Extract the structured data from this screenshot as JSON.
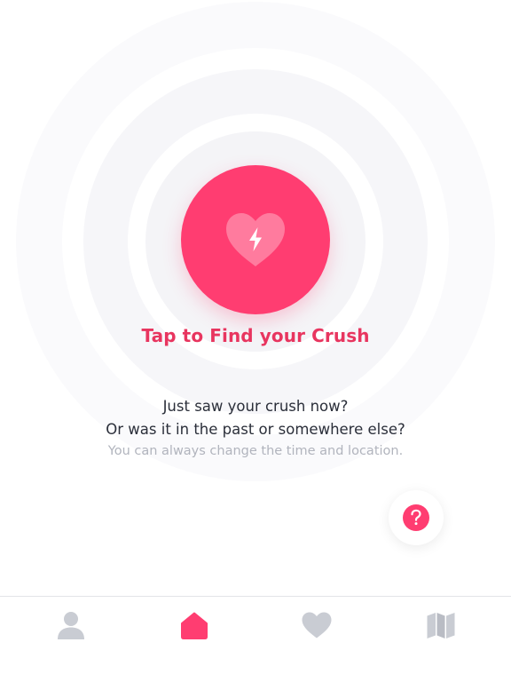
{
  "main": {
    "cta_title": "Tap to Find your Crush",
    "description_line1": "Just saw your crush now?",
    "description_line2": "Or was it in the past or somewhere else?",
    "hint": "You can always change the time and location.",
    "find_button_icon": "heart-bolt-icon",
    "help_button_icon": "question-icon"
  },
  "tabbar": {
    "active_tab": "home",
    "tabs": [
      {
        "id": "profile",
        "icon": "person-icon",
        "active": false
      },
      {
        "id": "home",
        "icon": "home-icon",
        "active": true
      },
      {
        "id": "likes",
        "icon": "heart-icon",
        "active": false
      },
      {
        "id": "map",
        "icon": "map-icon",
        "active": false
      }
    ]
  },
  "colors": {
    "accent": "#ff3d71",
    "title": "#e8355f",
    "text": "#2b2f3a",
    "muted": "#b1b4bd",
    "inactive_icon": "#c9ccd3"
  }
}
